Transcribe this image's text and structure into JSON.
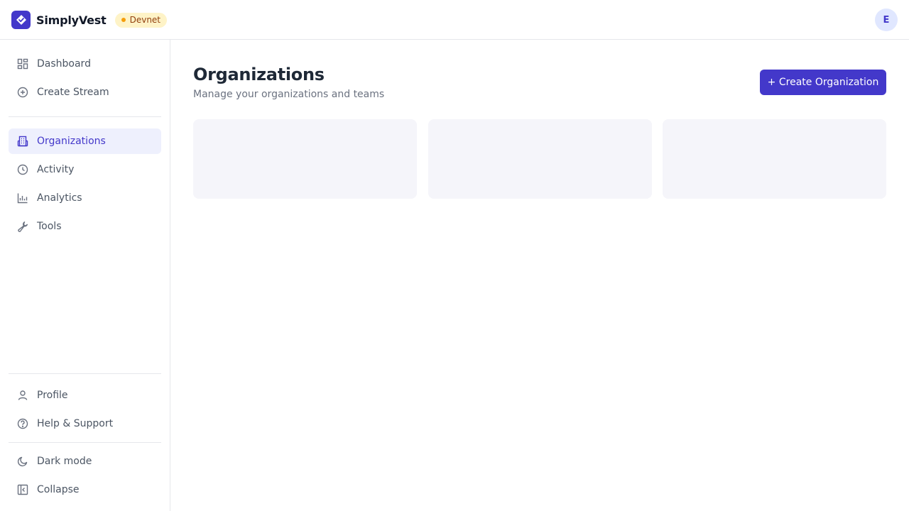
{
  "app": {
    "name": "SimplyVest",
    "network_badge": "Devnet",
    "user_initial": "E"
  },
  "sidebar": {
    "primary": [
      {
        "label": "Dashboard",
        "icon": "dashboard-icon"
      },
      {
        "label": "Create Stream",
        "icon": "plus-circle-icon"
      }
    ],
    "secondary": [
      {
        "label": "Organizations",
        "icon": "building-icon",
        "active": true
      },
      {
        "label": "Activity",
        "icon": "clock-icon"
      },
      {
        "label": "Analytics",
        "icon": "bar-chart-icon"
      },
      {
        "label": "Tools",
        "icon": "wrench-icon"
      }
    ],
    "account": [
      {
        "label": "Profile",
        "icon": "user-icon"
      },
      {
        "label": "Help & Support",
        "icon": "help-circle-icon"
      }
    ],
    "footer": [
      {
        "label": "Dark mode",
        "icon": "moon-icon"
      },
      {
        "label": "Collapse",
        "icon": "collapse-sidebar-icon"
      }
    ]
  },
  "main": {
    "title": "Organizations",
    "subtitle": "Manage your organizations and teams",
    "create_button": "+ Create Organization",
    "loading_cards": 3
  },
  "colors": {
    "accent": "#4338ca",
    "active_bg": "#eef0fd",
    "badge_bg": "#fef3c7",
    "badge_dot": "#f59e0b",
    "skeleton": "#f5f5fa"
  }
}
